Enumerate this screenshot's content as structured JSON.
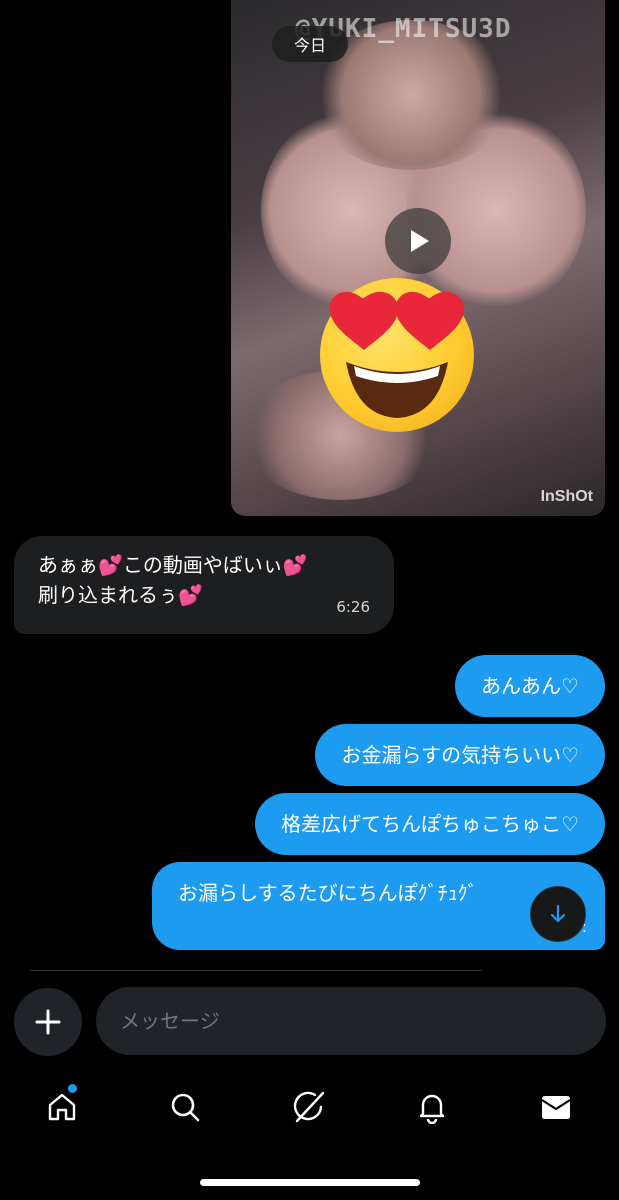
{
  "header": {
    "date_label": "今日"
  },
  "media": {
    "watermark": "@YUKI_MITSU3D",
    "app_watermark": "InShOt"
  },
  "incoming_message": {
    "line1": "あぁぁ💕この動画やばいぃ💕",
    "line2": "刷り込まれるぅ💕",
    "time": "6:26"
  },
  "outgoing_messages": [
    {
      "text": "あんあん♡"
    },
    {
      "text": "お金漏らすの気持ちいい♡"
    },
    {
      "text": "格差広げてちんぽちゅこちゅこ♡"
    },
    {
      "text": "お漏らしするたびにちんぽｸﾞﾁｭｸﾞ",
      "time": "6:"
    }
  ],
  "composer": {
    "placeholder": "メッセージ"
  },
  "icons": {
    "add": "plus-icon",
    "scroll": "arrow-down-icon",
    "home": "home-icon",
    "search": "search-icon",
    "grok": "grok-icon",
    "notifications": "bell-icon",
    "messages": "envelope-icon"
  },
  "colors": {
    "accent": "#1d9bf0",
    "incoming_bubble": "#1d1e20",
    "background": "#000000"
  }
}
